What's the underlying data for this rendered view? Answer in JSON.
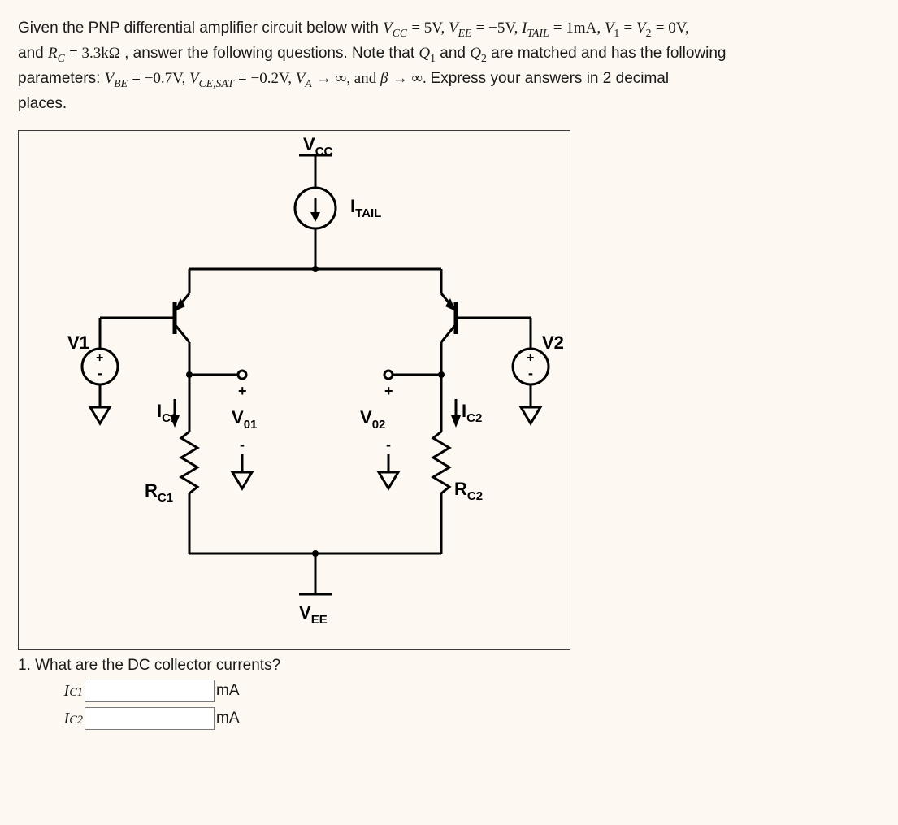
{
  "problem": {
    "line1_a": "Given the PNP differential amplifier circuit below with ",
    "vcc_var": "V",
    "vcc_sub": "CC",
    "eq": " = ",
    "vcc_val": "5V, ",
    "vee_var": "V",
    "vee_sub": "EE",
    "vee_val": "−5V, ",
    "itail_var": "I",
    "itail_sub": "TAIL",
    "itail_val": "1mA, ",
    "v1_var": "V",
    "v1_sub": "1",
    "v2_var": "V",
    "v2_sub": "2",
    "v12_val": "0V,",
    "line2_a": "and ",
    "rc_var": "R",
    "rc_sub": "C",
    "rc_val": "3.3kΩ",
    "line2_b": ", answer the following questions. Note that ",
    "q1_var": "Q",
    "q1_sub": "1",
    "line2_c": " and ",
    "q2_var": "Q",
    "q2_sub": "2",
    "line2_d": " are matched and has the following",
    "line3_a": "parameters: ",
    "vbe_var": "V",
    "vbe_sub": "BE",
    "vbe_val": "−0.7V, ",
    "vcesat_var": "V",
    "vcesat_sub": "CE,SAT",
    "vcesat_val": "−0.2V, ",
    "va_var": "V",
    "va_sub": "A",
    "va_val": " → ∞, and ",
    "beta_var": "β",
    "beta_val": " → ∞. ",
    "line3_b": "Express your answers in 2 decimal",
    "line4": "places."
  },
  "circuit_labels": {
    "vcc": "V",
    "vcc_sub": "CC",
    "itail": "I",
    "itail_sub": "TAIL",
    "v1": "V1",
    "v2": "V2",
    "ic1": "I",
    "ic1_sub": "C1",
    "ic2": "I",
    "ic2_sub": "C2",
    "vo1": "V",
    "vo1_sub": "01",
    "vo2": "V",
    "vo2_sub": "02",
    "rc1": "R",
    "rc1_sub": "C1",
    "rc2": "R",
    "rc2_sub": "C2",
    "vee": "V",
    "vee_sub": "EE",
    "plus": "+",
    "minus": "-"
  },
  "question1": {
    "text": "1. What are the DC collector currents?",
    "row1_label": "I",
    "row1_sub": "C1",
    "row1_unit": "mA",
    "row2_label": "I",
    "row2_sub": "C2",
    "row2_unit": "mA"
  }
}
